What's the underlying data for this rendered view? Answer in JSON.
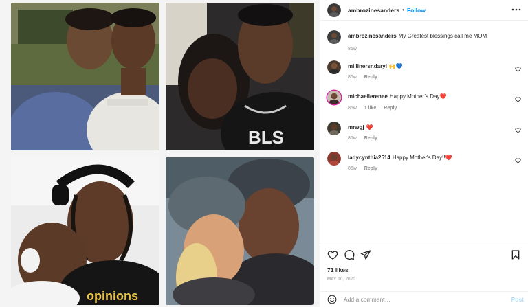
{
  "header": {
    "username": "ambrozinesanders",
    "separator": "•",
    "follow_label": "Follow",
    "more_label": "•••"
  },
  "caption": {
    "username": "ambrozinesanders",
    "text": "My Greatest blessings call me MOM",
    "time": "86w"
  },
  "comments": [
    {
      "username": "millinersr.daryl",
      "text": "🙌💙",
      "time": "86w",
      "likes": "",
      "reply": "Reply"
    },
    {
      "username": "michaellerenee",
      "text": "Happy Mother’s Day❤️",
      "time": "86w",
      "likes": "1 like",
      "reply": "Reply"
    },
    {
      "username": "mrwgj",
      "text": "❤️",
      "time": "86w",
      "likes": "",
      "reply": "Reply"
    },
    {
      "username": "ladycynthia2514",
      "text": "Happy Mother's Day!!❤️",
      "time": "86w",
      "likes": "",
      "reply": "Reply"
    }
  ],
  "likes_text": "71 likes",
  "date_text": "MAY 10, 2020",
  "add_comment": {
    "placeholder": "Add a comment…",
    "post_label": "Post"
  },
  "colors": {
    "link": "#0095f6",
    "post_disabled": "#b2dffc",
    "heart": "#ed4956",
    "meta": "#8e8e8e"
  },
  "icons": [
    "more-icon",
    "heart-icon",
    "comment-icon",
    "share-icon",
    "bookmark-icon",
    "emoji-icon"
  ]
}
